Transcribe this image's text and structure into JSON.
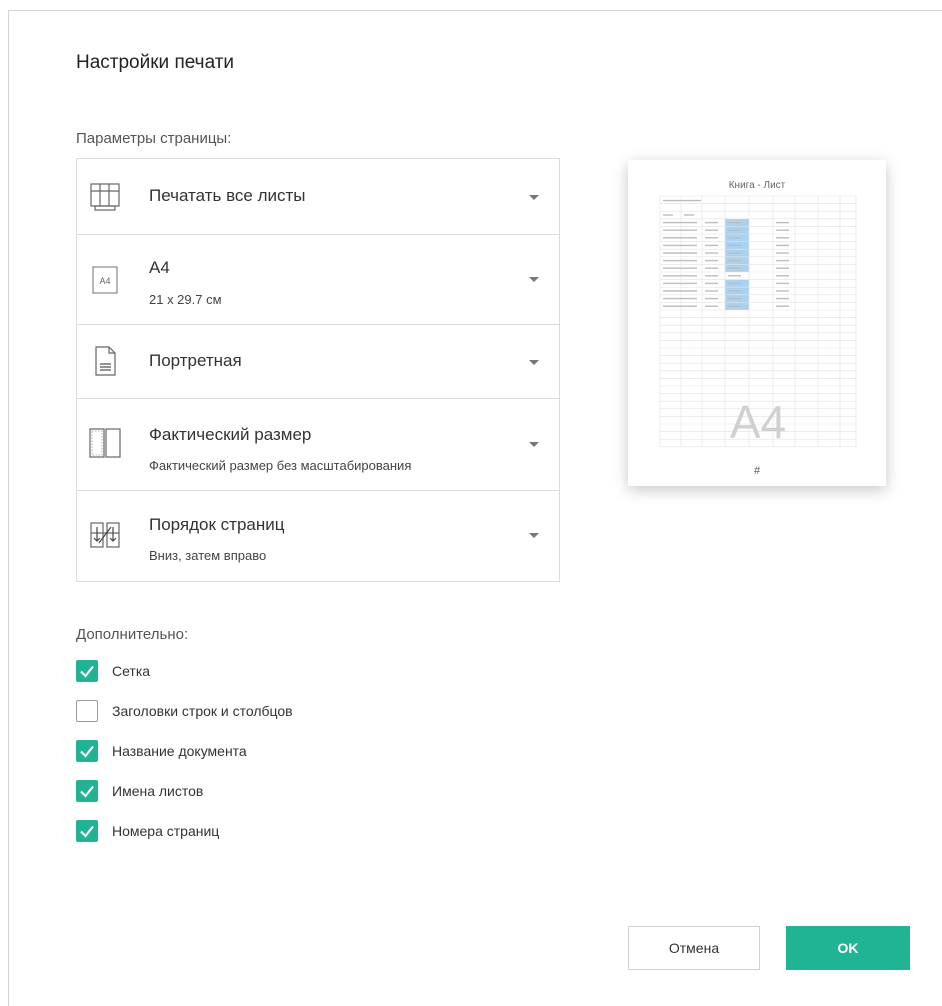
{
  "dialog": {
    "title": "Настройки печати"
  },
  "page_params": {
    "label": "Параметры страницы:",
    "rows": [
      {
        "icon": "sheets-icon",
        "main": "Печатать все листы",
        "sub": ""
      },
      {
        "icon": "paper-size-icon",
        "icon_text": "A4",
        "main": "A4",
        "sub": "21 x 29.7 см"
      },
      {
        "icon": "portrait-icon",
        "main": "Портретная",
        "sub": ""
      },
      {
        "icon": "scale-icon",
        "main": "Фактический размер",
        "sub": "Фактический размер без масштабирования"
      },
      {
        "icon": "page-order-icon",
        "main": "Порядок страниц",
        "sub": "Вниз, затем вправо"
      }
    ]
  },
  "preview": {
    "header": "Книга - Лист",
    "watermark": "A4",
    "footer": "#"
  },
  "extra": {
    "label": "Дополнительно:",
    "options": [
      {
        "label": "Сетка",
        "checked": true
      },
      {
        "label": "Заголовки строк и столбцов",
        "checked": false
      },
      {
        "label": "Название документа",
        "checked": true
      },
      {
        "label": "Имена листов",
        "checked": true
      },
      {
        "label": "Номера страниц",
        "checked": true
      }
    ]
  },
  "buttons": {
    "cancel": "Отмена",
    "ok": "OK"
  },
  "colors": {
    "accent": "#20b394",
    "preview_highlight": "#a9d1f2"
  }
}
